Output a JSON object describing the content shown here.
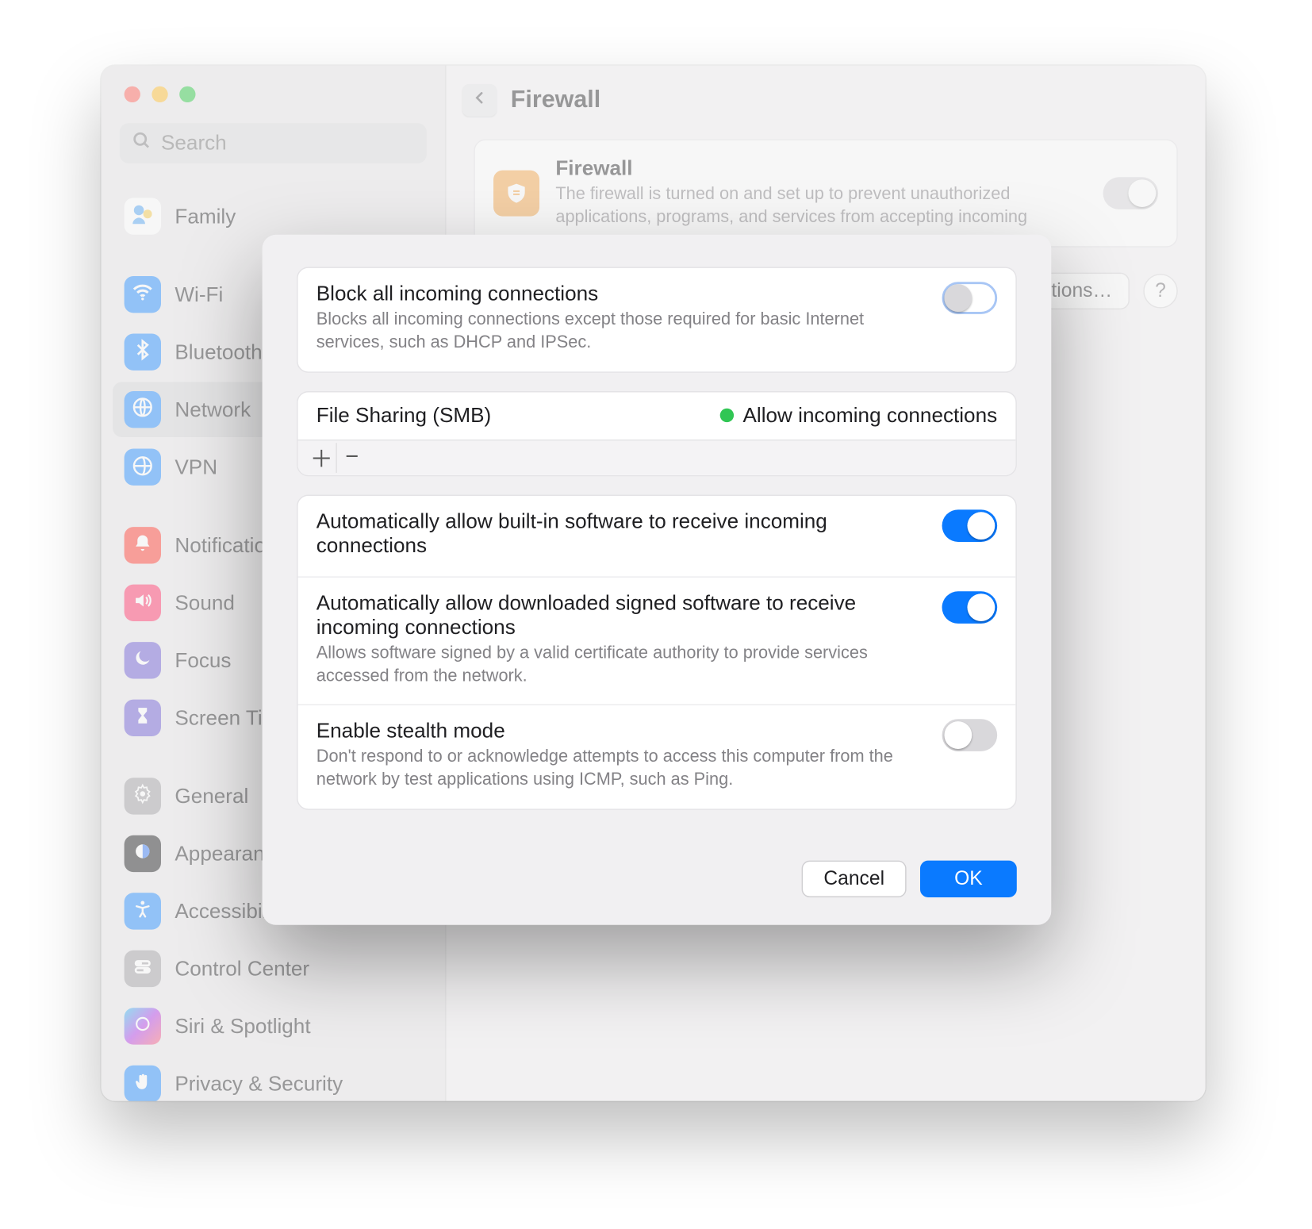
{
  "search": {
    "placeholder": "Search"
  },
  "page_title": "Firewall",
  "sidebar": {
    "items": [
      {
        "label": "Family"
      },
      {
        "label": "Wi-Fi"
      },
      {
        "label": "Bluetooth"
      },
      {
        "label": "Network"
      },
      {
        "label": "VPN"
      },
      {
        "label": "Notifications"
      },
      {
        "label": "Sound"
      },
      {
        "label": "Focus"
      },
      {
        "label": "Screen Time"
      },
      {
        "label": "General"
      },
      {
        "label": "Appearance"
      },
      {
        "label": "Accessibility"
      },
      {
        "label": "Control Center"
      },
      {
        "label": "Siri & Spotlight"
      },
      {
        "label": "Privacy & Security"
      }
    ]
  },
  "firewall_card": {
    "title": "Firewall",
    "desc": "The firewall is turned on and set up to prevent unauthorized applications, programs, and services from accepting incoming"
  },
  "options_button": "Options…",
  "modal": {
    "block_all": {
      "title": "Block all incoming connections",
      "desc": "Blocks all incoming connections except those required for basic Internet services, such as DHCP and IPSec.",
      "enabled": false
    },
    "table": {
      "app_name": "File Sharing (SMB)",
      "status_text": "Allow incoming connections"
    },
    "auto_builtin": {
      "title": "Automatically allow built-in software to receive incoming connections",
      "enabled": true
    },
    "auto_signed": {
      "title": "Automatically allow downloaded signed software to receive incoming connections",
      "desc": "Allows software signed by a valid certificate authority to provide services accessed from the network.",
      "enabled": true
    },
    "stealth": {
      "title": "Enable stealth mode",
      "desc": "Don't respond to or acknowledge attempts to access this computer from the network by test applications using ICMP, such as Ping.",
      "enabled": false
    },
    "cancel": "Cancel",
    "ok": "OK"
  }
}
